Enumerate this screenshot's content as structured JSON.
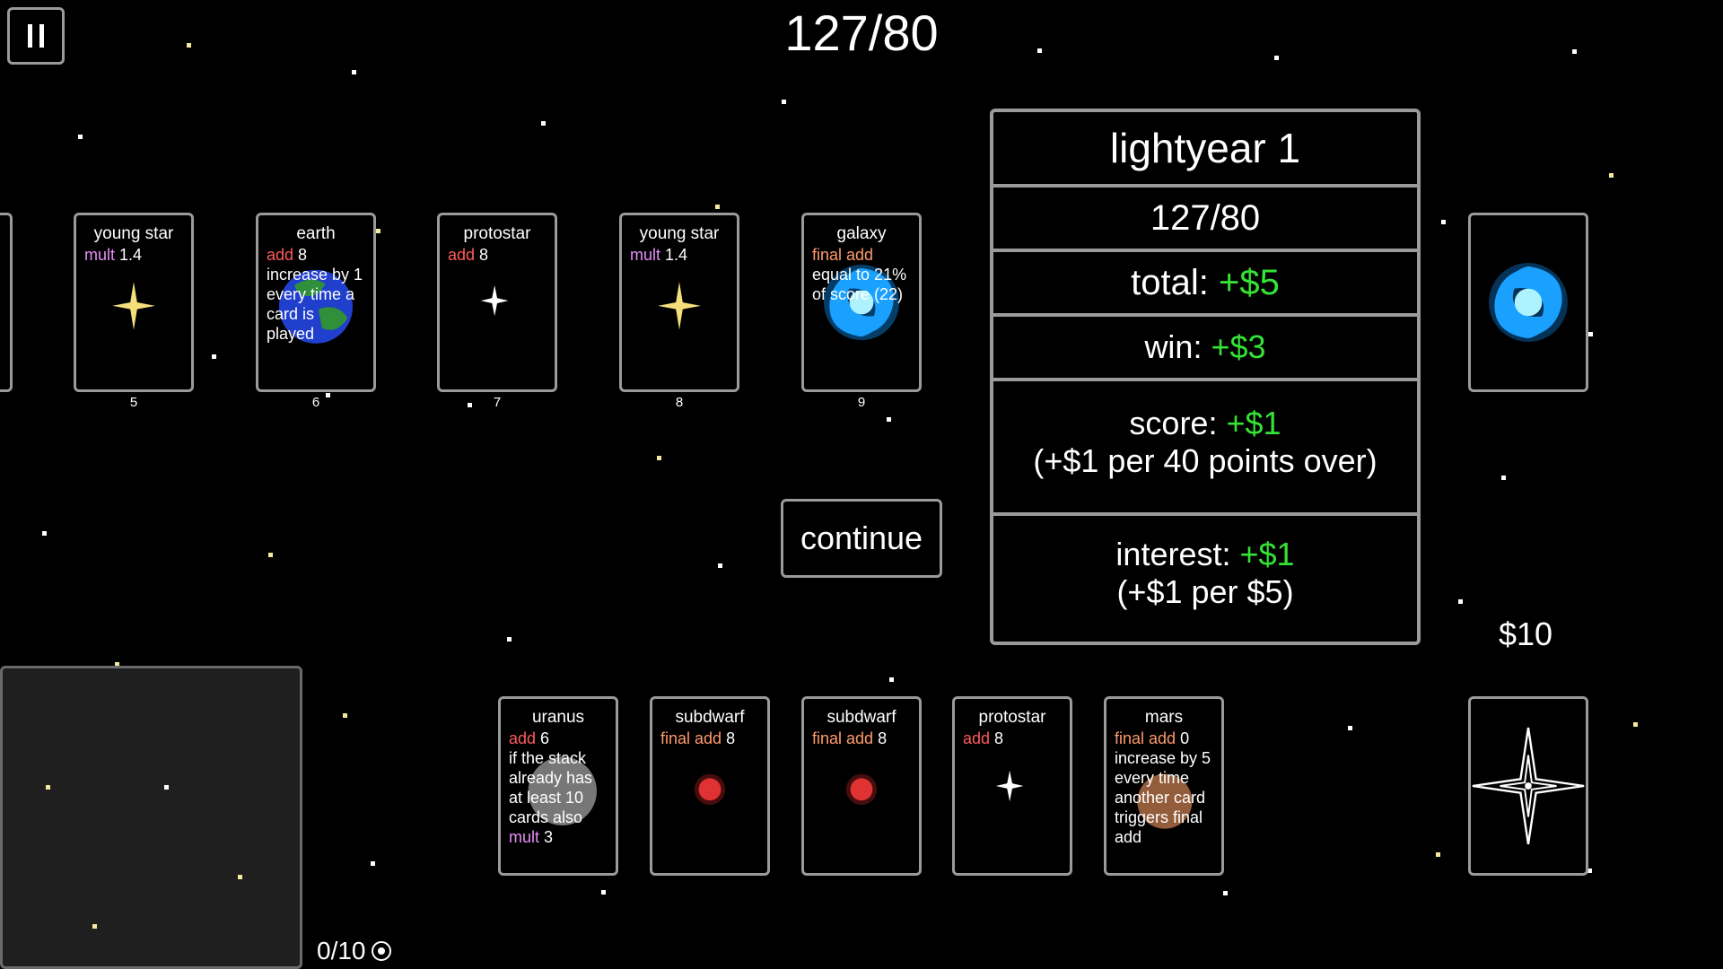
{
  "hud": {
    "score": "127/80",
    "money": "$10",
    "deck_count": "0/10"
  },
  "played_cards": [
    {
      "name": "young star",
      "effects": [
        {
          "kw": "mult",
          "val": " 1.4"
        }
      ],
      "desc": "",
      "index": "5",
      "art": "yellow-star"
    },
    {
      "name": "earth",
      "effects": [
        {
          "kw": "add",
          "val": " 8"
        }
      ],
      "desc": "increase by 1 every time a card is played",
      "index": "6",
      "art": "earth"
    },
    {
      "name": "protostar",
      "effects": [
        {
          "kw": "add",
          "val": " 8"
        }
      ],
      "desc": "",
      "index": "7",
      "art": "small-white-star"
    },
    {
      "name": "young star",
      "effects": [
        {
          "kw": "mult",
          "val": " 1.4"
        }
      ],
      "desc": "",
      "index": "8",
      "art": "yellow-star"
    },
    {
      "name": "galaxy",
      "effects": [
        {
          "kw": "final add",
          "val": ""
        }
      ],
      "desc": "equal to 21% of score (22)",
      "index": "9",
      "art": "galaxy"
    }
  ],
  "results_panel": {
    "title": "lightyear 1",
    "score": "127/80",
    "total_label": "total:",
    "total_value": "+$5",
    "win_label": "win:",
    "win_value": "+$3",
    "score_label": "score:",
    "score_value": "+$1",
    "score_note": "(+$1 per 40 points over)",
    "interest_label": "interest:",
    "interest_value": "+$1",
    "interest_note": "(+$1 per $5)"
  },
  "continue_label": "continue",
  "hand_cards": [
    {
      "name": "uranus",
      "effects": [
        {
          "kw": "add",
          "val": " 6"
        }
      ],
      "desc": "if the stack already has at least 10 cards also",
      "desc_kw": "mult",
      "desc_val": " 3",
      "art": "uranus"
    },
    {
      "name": "subdwarf",
      "effects": [
        {
          "kw": "final add",
          "val": " 8"
        }
      ],
      "desc": "",
      "art": "red-dot"
    },
    {
      "name": "subdwarf",
      "effects": [
        {
          "kw": "final add",
          "val": " 8"
        }
      ],
      "desc": "",
      "art": "red-dot"
    },
    {
      "name": "protostar",
      "effects": [
        {
          "kw": "add",
          "val": " 8"
        }
      ],
      "desc": "",
      "art": "small-white-star"
    },
    {
      "name": "mars",
      "effects": [
        {
          "kw": "final add",
          "val": " 0"
        }
      ],
      "desc": "increase by 5 every time another card triggers final add",
      "art": "mars"
    }
  ],
  "colors": {
    "add": "#ff5a5a",
    "mult": "#e58ef5",
    "final": "#ff9a6a",
    "money_gain": "#35e235",
    "border": "#9a9a9a"
  }
}
